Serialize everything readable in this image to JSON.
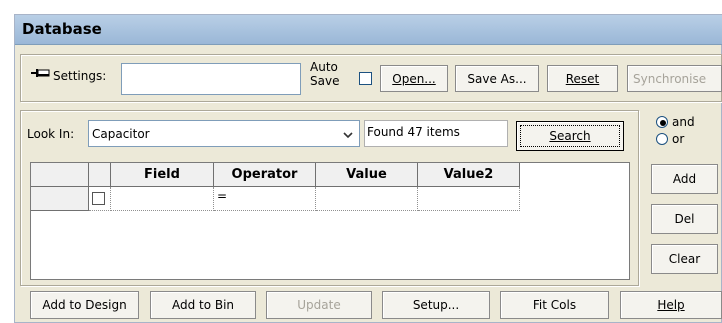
{
  "title": "Database",
  "settings": {
    "label": "Settings:",
    "value": "",
    "auto_save_line1": "Auto",
    "auto_save_line2": "Save",
    "open_button": "Open...",
    "save_as_button": "Save As...",
    "reset_button": "Reset",
    "synchronise_button": "Synchronise"
  },
  "search": {
    "look_in_label": "Look In:",
    "look_in_value": "Capacitor",
    "found_text": "Found 47 items",
    "search_button": "Search",
    "logic": {
      "and_label": "and",
      "or_label": "or",
      "selected": "and"
    }
  },
  "grid": {
    "columns": [
      "Field",
      "Operator",
      "Value",
      "Value2"
    ],
    "rows": [
      {
        "checked": false,
        "field": "",
        "operator": "=",
        "value": "",
        "value2": ""
      }
    ]
  },
  "side_buttons": {
    "add": "Add",
    "del": "Del",
    "clear": "Clear"
  },
  "bottom_buttons": {
    "add_to_design": "Add to Design",
    "add_to_bin": "Add to Bin",
    "update": "Update",
    "setup": "Setup...",
    "fit_cols": "Fit Cols",
    "help": "Help"
  }
}
